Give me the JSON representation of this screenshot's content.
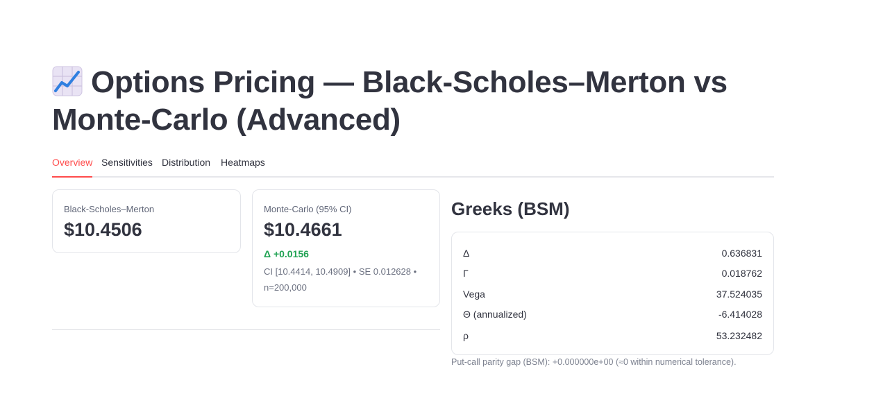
{
  "header": {
    "title_icon": "chart-increasing-icon",
    "title": "Options Pricing — Black-Scholes–Merton vs Monte-Carlo (Advanced)"
  },
  "tabs": [
    {
      "label": "Overview",
      "active": true
    },
    {
      "label": "Sensitivities",
      "active": false
    },
    {
      "label": "Distribution",
      "active": false
    },
    {
      "label": "Heatmaps",
      "active": false
    }
  ],
  "metrics": {
    "bsm": {
      "label": "Black-Scholes–Merton",
      "value": "$10.4506"
    },
    "mc": {
      "label": "Monte-Carlo (95% CI)",
      "value": "$10.4661",
      "delta": "Δ +0.0156",
      "help": "CI [10.4414, 10.4909] • SE 0.012628 • n=200,000"
    }
  },
  "greeks": {
    "title": "Greeks (BSM)",
    "rows": [
      {
        "name": "Δ",
        "value": "0.636831"
      },
      {
        "name": "Γ",
        "value": "0.018762"
      },
      {
        "name": "Vega",
        "value": "37.524035"
      },
      {
        "name": "Θ (annualized)",
        "value": "-6.414028"
      },
      {
        "name": "ρ",
        "value": "53.232482"
      }
    ],
    "caption": "Put-call parity gap (BSM): +0.000000e+00 (≈0 within numerical tolerance)."
  },
  "colors": {
    "accent": "#ff4b4b",
    "delta_positive": "#21a354",
    "text": "#31333f"
  }
}
